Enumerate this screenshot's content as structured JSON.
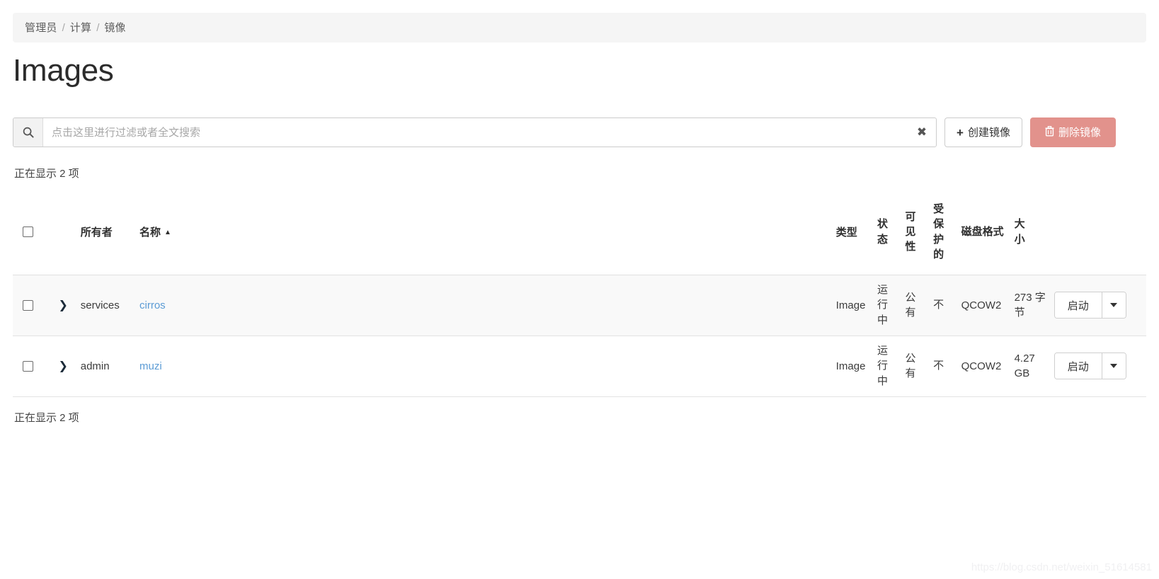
{
  "breadcrumb": {
    "items": [
      "管理员",
      "计算",
      "镜像"
    ],
    "separator": "/"
  },
  "page_title": "Images",
  "toolbar": {
    "search_placeholder": "点击这里进行过滤或者全文搜索",
    "search_value": "",
    "search_icon": "search-icon",
    "clear_label": "✖",
    "create_label": "创建镜像",
    "create_icon": "plus-icon",
    "delete_label": "删除镜像",
    "delete_icon": "trash-icon",
    "delete_color": "#e2928c"
  },
  "counts": {
    "top": "正在显示 2 项",
    "bottom": "正在显示 2 项"
  },
  "table": {
    "headers": {
      "owner": "所有者",
      "name": "名称",
      "name_sort": "▲",
      "type": "类型",
      "status": "状态",
      "visibility": "可见性",
      "protected": "受保护的",
      "disk_format": "磁盘格式",
      "size": "大小"
    },
    "rows": [
      {
        "owner": "services",
        "name": "cirros",
        "type": "Image",
        "status": "运行中",
        "visibility": "公有",
        "protected": "不",
        "disk_format": "QCOW2",
        "size": "273 字节",
        "action_label": "启动"
      },
      {
        "owner": "admin",
        "name": "muzi",
        "type": "Image",
        "status": "运行中",
        "visibility": "公有",
        "protected": "不",
        "disk_format": "QCOW2",
        "size": "4.27 GB",
        "action_label": "启动"
      }
    ]
  },
  "watermark": "https://blog.csdn.net/weixin_51614581"
}
